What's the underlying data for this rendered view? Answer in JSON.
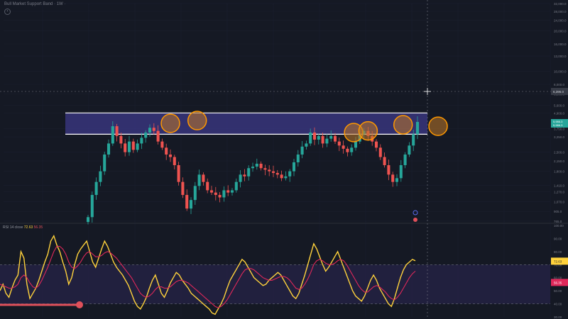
{
  "header": {
    "title": "Bull Market Support Band",
    "title_extra": "· 1W ·"
  },
  "price_axis": {
    "labels": [
      "32,000.0",
      "28,000.0",
      "24,000.0",
      "20,000.0",
      "16,000.0",
      "13,000.0",
      "10,000.0",
      "8,000.0",
      "6,800.0",
      "5,600.0",
      "4,900.0",
      "3,750.0",
      "3,250.0",
      "2,500.0",
      "2,150.0",
      "1,800.0",
      "1,410.0",
      "1,270.0",
      "1,070.0",
      "905.0",
      "765.0"
    ],
    "current_price_badge": "5,986.3",
    "current_price_badge_sub": "5,986.3",
    "crosshair_price": "6,396.0"
  },
  "rsi_panel": {
    "label": "RSI 14 close",
    "value_rsi": "72.63",
    "value_ma": "56.35",
    "axis_labels": [
      "100.00",
      "90.00",
      "80.00",
      "70.00",
      "60.00",
      "50.00",
      "40.00",
      "30.00"
    ]
  },
  "colors": {
    "background": "#151924",
    "up_candle": "#26a69a",
    "down_candle": "#ef5350",
    "band_fill": "#3f3a8f",
    "band_border": "#ffffff",
    "highlight_circle": "#ff9800",
    "rsi_line": "#ffd23c",
    "rsi_ma": "#e0285a",
    "rsi_band": "#2a2550",
    "slider": "#e0505a"
  },
  "chart_data": [
    {
      "type": "candlestick",
      "title": "",
      "ylabel": "",
      "yscale": "log",
      "ylim": [
        765,
        32000
      ],
      "resistance_band": [
        3400,
        4900
      ],
      "highlighted_touches": [
        {
          "x": 40,
          "price": 4100
        },
        {
          "x": 53,
          "price": 4300
        },
        {
          "x": 129,
          "price": 3500
        },
        {
          "x": 136,
          "price": 3600
        },
        {
          "x": 153,
          "price": 4000
        },
        {
          "x": 170,
          "price": 3900
        }
      ],
      "closes": [
        820,
        1200,
        1500,
        1800,
        2400,
        2900,
        3900,
        3300,
        2900,
        2500,
        3000,
        2600,
        2900,
        3200,
        3500,
        3800,
        3600,
        3000,
        2700,
        2400,
        2300,
        2000,
        1500,
        1200,
        950,
        1100,
        1400,
        1700,
        1500,
        1300,
        1250,
        1200,
        1150,
        1300,
        1250,
        1300,
        1500,
        1700,
        1650,
        1900,
        1950,
        2050,
        1900,
        1850,
        1800,
        1750,
        1700,
        1600,
        1650,
        1800,
        2100,
        2400,
        2750,
        2900,
        3500,
        3100,
        3300,
        2900,
        3150,
        3300,
        3000,
        2800,
        2650,
        2500,
        2700,
        3000,
        3400,
        3600,
        3300,
        3000,
        2700,
        2300,
        2000,
        1700,
        1500,
        1600,
        2000,
        2400,
        2800,
        3400,
        4200
      ]
    },
    {
      "type": "line",
      "title": "",
      "ylabel": "",
      "ylim": [
        30,
        100
      ],
      "band": [
        40,
        70
      ],
      "series": [
        {
          "name": "RSI",
          "values": [
            50,
            55,
            48,
            45,
            52,
            58,
            62,
            80,
            75,
            55,
            44,
            48,
            52,
            58,
            65,
            72,
            78,
            88,
            92,
            85,
            80,
            72,
            65,
            55,
            60,
            70,
            78,
            82,
            85,
            88,
            80,
            72,
            68,
            75,
            82,
            88,
            84,
            78,
            72,
            68,
            65,
            62,
            58,
            54,
            48,
            42,
            38,
            36,
            40,
            45,
            52,
            58,
            62,
            55,
            48,
            45,
            50,
            56,
            60,
            64,
            62,
            58,
            55,
            52,
            48,
            46,
            44,
            42,
            40,
            38,
            36,
            33,
            32,
            36,
            40,
            45,
            52,
            58,
            62,
            66,
            70,
            74,
            72,
            68,
            64,
            60,
            58,
            56,
            54,
            55,
            58,
            60,
            62,
            64,
            62,
            58,
            54,
            50,
            46,
            44,
            48,
            55,
            62,
            70,
            78,
            86,
            82,
            76,
            70,
            65,
            68,
            72,
            76,
            80,
            74,
            68,
            62,
            56,
            50,
            46,
            44,
            42,
            46,
            52,
            58,
            62,
            58,
            52,
            48,
            44,
            40,
            38,
            44,
            52,
            60,
            66,
            70,
            72,
            74,
            73
          ],
          "color": "#ffd23c"
        },
        {
          "name": "MA",
          "values": [
            55,
            54,
            53,
            52,
            52,
            53,
            55,
            60,
            62,
            60,
            56,
            53,
            52,
            54,
            58,
            63,
            68,
            74,
            80,
            84,
            84,
            82,
            78,
            72,
            68,
            67,
            69,
            72,
            76,
            79,
            80,
            78,
            76,
            76,
            77,
            79,
            80,
            79,
            77,
            75,
            72,
            69,
            66,
            63,
            60,
            56,
            52,
            48,
            46,
            45,
            46,
            48,
            51,
            53,
            53,
            52,
            52,
            53,
            55,
            57,
            58,
            58,
            57,
            56,
            54,
            52,
            50,
            48,
            46,
            44,
            42,
            40,
            38,
            37,
            38,
            40,
            43,
            47,
            51,
            55,
            59,
            63,
            66,
            67,
            67,
            66,
            64,
            62,
            60,
            59,
            58,
            58,
            59,
            60,
            61,
            61,
            60,
            58,
            55,
            52,
            51,
            52,
            55,
            59,
            64,
            70,
            73,
            74,
            73,
            71,
            70,
            70,
            71,
            73,
            74,
            73,
            70,
            66,
            62,
            58,
            54,
            51,
            49,
            49,
            51,
            53,
            54,
            53,
            51,
            49,
            46,
            44,
            43,
            45,
            48,
            52,
            56,
            60,
            63,
            65
          ],
          "color": "#e0285a"
        }
      ]
    }
  ]
}
